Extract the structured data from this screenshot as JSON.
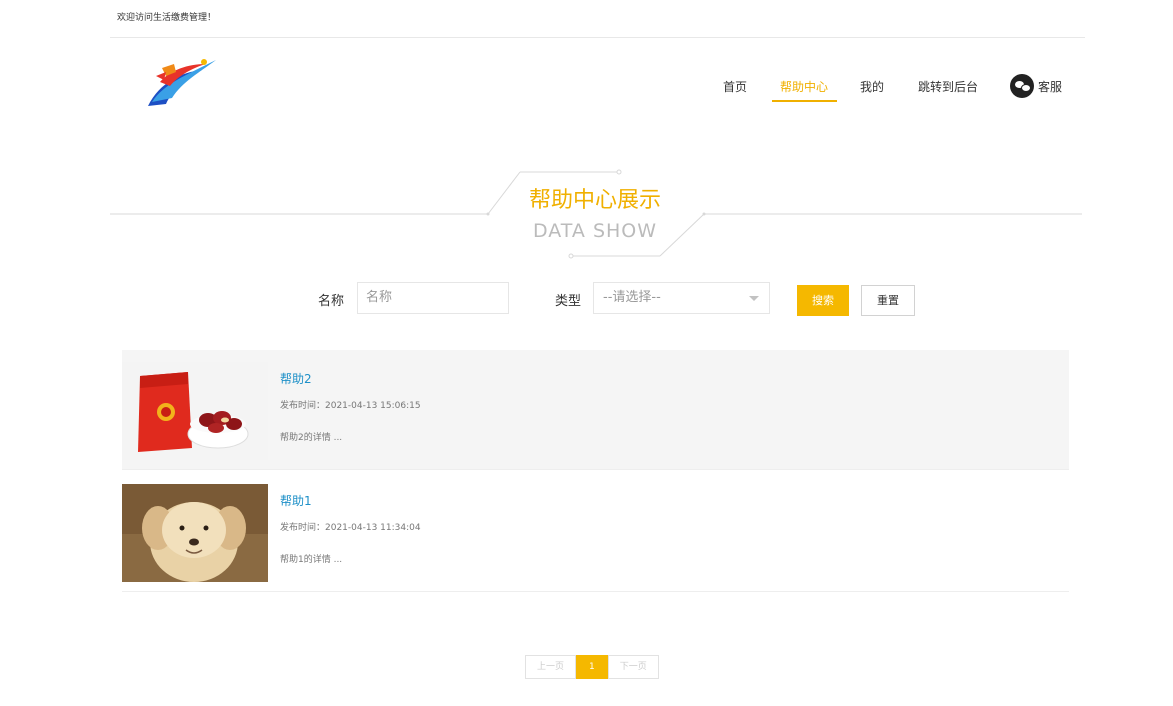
{
  "topbar": {
    "welcome": "欢迎访问生活缴费管理！"
  },
  "nav": {
    "items": [
      {
        "label": "首页"
      },
      {
        "label": "帮助中心"
      },
      {
        "label": "我的"
      },
      {
        "label": "跳转到后台"
      }
    ],
    "active_index": 1,
    "service_label": "客服"
  },
  "section": {
    "title": "帮助中心展示",
    "subtitle": "DATA SHOW"
  },
  "search": {
    "name_label": "名称",
    "name_placeholder": "名称",
    "type_label": "类型",
    "type_selected": "--请选择--",
    "search_button": "搜索",
    "reset_button": "重置"
  },
  "items": [
    {
      "title": "帮助2",
      "time": "发布时间：2021-04-13 15:06:15",
      "desc": "帮助2的详情 ..."
    },
    {
      "title": "帮助1",
      "time": "发布时间：2021-04-13 11:34:04",
      "desc": "帮助1的详情 ..."
    }
  ],
  "pager": {
    "prev": "上一页",
    "current": "1",
    "next": "下一页"
  },
  "colors": {
    "accent": "#f5b800",
    "link": "#1e90c8"
  }
}
